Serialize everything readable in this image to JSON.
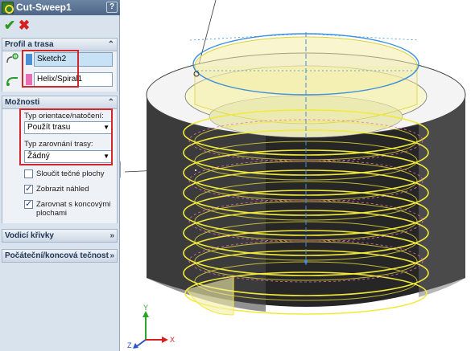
{
  "title_bar": {
    "title": "Cut-Sweep1",
    "help_label": "?"
  },
  "actions": {
    "ok_glyph": "✔",
    "cancel_glyph": "✖"
  },
  "profile_section": {
    "header": "Profil a trasa",
    "profile_value": "Sketch2",
    "path_value": "Helix/Spiral1",
    "profile_color": "#4a90d9",
    "path_color": "#e86fb5"
  },
  "options_section": {
    "header": "Možnosti",
    "orientation_label": "Typ orientace/natočení:",
    "orientation_value": "Použít trasu",
    "alignment_label": "Typ zarovnání trasy:",
    "alignment_value": "Žádný",
    "merge_tangent_label": "Sloučit tečné plochy",
    "merge_tangent_checked": false,
    "show_preview_label": "Zobrazit náhled",
    "show_preview_checked": true,
    "align_end_label": "Zarovnat s koncovými plochami",
    "align_end_checked": true
  },
  "guide_curves_section": {
    "header": "Vodicí křivky"
  },
  "tangency_section": {
    "header": "Počáteční/koncová tečnost"
  },
  "chevron_glyph": "⌄",
  "colors": {
    "highlight_red": "#d1262b",
    "helix_yellow": "#f2ea3a",
    "sketch_blue": "#3d8fe0",
    "body_dark": "#2a2a2a"
  },
  "triad": {
    "x_label": "X",
    "y_label": "Y",
    "z_label": "Z"
  }
}
